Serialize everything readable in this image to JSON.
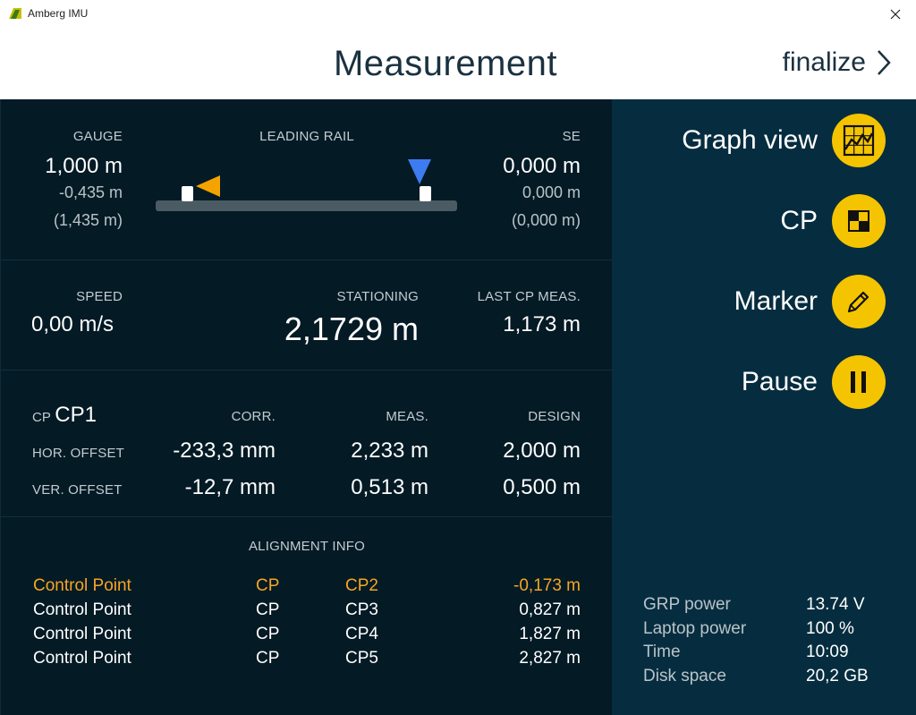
{
  "window": {
    "title": "Amberg IMU"
  },
  "header": {
    "title": "Measurement",
    "finalize_label": "finalize"
  },
  "rail_section": {
    "gauge": {
      "label": "GAUGE",
      "value": "1,000 m",
      "delta": "-0,435 m",
      "nominal": "(1,435 m)"
    },
    "leading_rail": {
      "label": "LEADING RAIL"
    },
    "se": {
      "label": "SE",
      "value": "0,000 m",
      "delta": "0,000 m",
      "nominal": "(0,000 m)"
    },
    "colors": {
      "left_marker": "#f5a300",
      "right_marker": "#3d7bf0"
    }
  },
  "speed_section": {
    "speed": {
      "label": "SPEED",
      "value": "0,00 m/s"
    },
    "stationing": {
      "label": "STATIONING",
      "value": "2,1729 m"
    },
    "last_cp": {
      "label": "LAST CP MEAS.",
      "value": "1,173 m"
    }
  },
  "cp_section": {
    "cp_prefix": "CP",
    "cp_name": "CP1",
    "headers": {
      "corr": "CORR.",
      "meas": "MEAS.",
      "design": "DESIGN"
    },
    "rows": [
      {
        "label": "HOR. OFFSET",
        "corr": "-233,3 mm",
        "meas": "2,233 m",
        "design": "2,000 m"
      },
      {
        "label": "VER. OFFSET",
        "corr": "-12,7 mm",
        "meas": "0,513 m",
        "design": "0,500 m"
      }
    ]
  },
  "alignment": {
    "title": "ALIGNMENT INFO",
    "highlight_color": "#f5a623",
    "rows": [
      {
        "type": "Control Point",
        "code": "CP",
        "name": "CP2",
        "distance": "-0,173 m",
        "highlighted": true
      },
      {
        "type": "Control Point",
        "code": "CP",
        "name": "CP3",
        "distance": "0,827 m",
        "highlighted": false
      },
      {
        "type": "Control Point",
        "code": "CP",
        "name": "CP4",
        "distance": "1,827 m",
        "highlighted": false
      },
      {
        "type": "Control Point",
        "code": "CP",
        "name": "CP5",
        "distance": "2,827 m",
        "highlighted": false
      }
    ]
  },
  "sidebar": {
    "accent": "#f5c400",
    "items": [
      {
        "label": "Graph view",
        "icon": "graph-icon"
      },
      {
        "label": "CP",
        "icon": "checker-icon"
      },
      {
        "label": "Marker",
        "icon": "pencil-icon"
      },
      {
        "label": "Pause",
        "icon": "pause-icon"
      }
    ],
    "status": [
      {
        "label": "GRP power",
        "value": "13.74 V"
      },
      {
        "label": "Laptop power",
        "value": "100 %"
      },
      {
        "label": "Time",
        "value": "10:09"
      },
      {
        "label": "Disk space",
        "value": "20,2 GB"
      }
    ]
  }
}
